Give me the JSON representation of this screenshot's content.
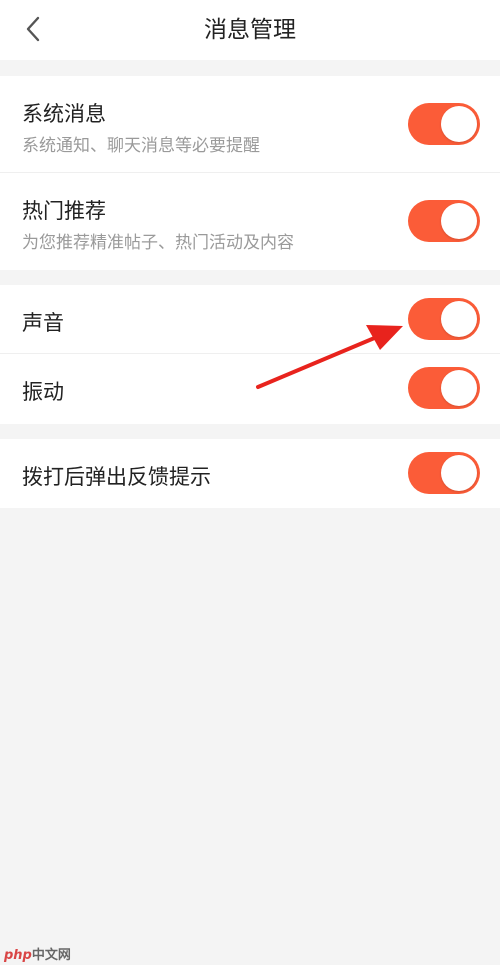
{
  "header": {
    "title": "消息管理",
    "back_icon": "chevron-left-icon"
  },
  "sections": [
    [
      {
        "label": "系统消息",
        "sub": "系统通知、聊天消息等必要提醒",
        "on": true
      },
      {
        "label": "热门推荐",
        "sub": "为您推荐精准帖子、热门活动及内容",
        "on": true
      }
    ],
    [
      {
        "label": "声音",
        "on": true
      },
      {
        "label": "振动",
        "on": true
      }
    ],
    [
      {
        "label": "拨打后弹出反馈提示",
        "on": true
      }
    ]
  ],
  "colors": {
    "toggle_on": "#fb5c38",
    "annotation_arrow": "#e8231d"
  },
  "watermark": {
    "brand": "php",
    "text": "中文网"
  }
}
